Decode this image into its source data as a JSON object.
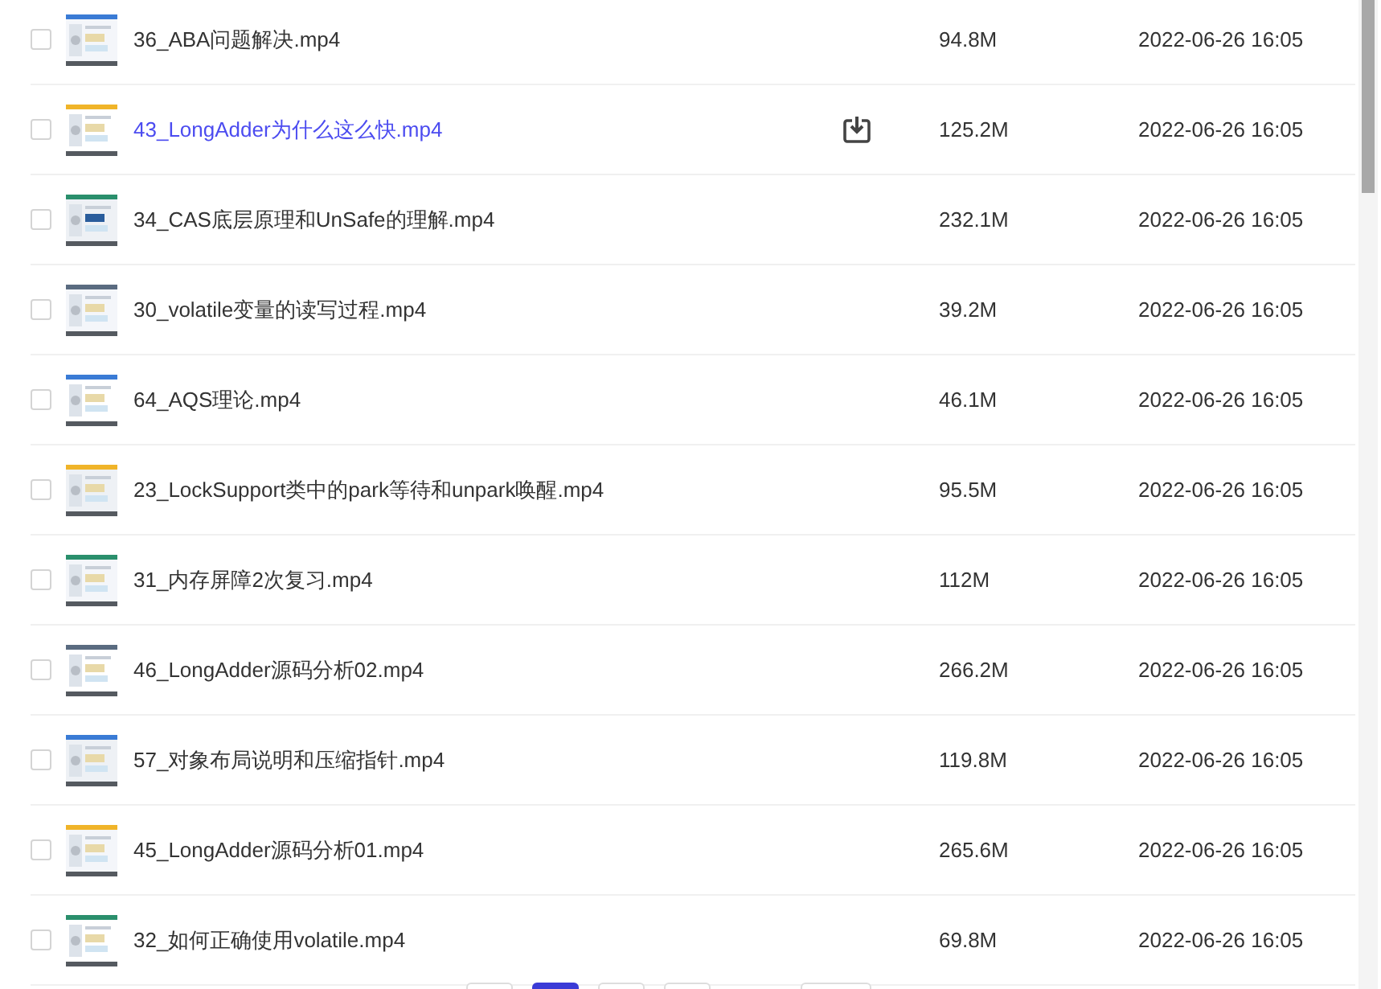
{
  "files": [
    {
      "name": "36_ABA问题解决.mp4",
      "size": "94.8M",
      "date": "2022-06-26 16:05",
      "checked": false,
      "hovered": false
    },
    {
      "name": "43_LongAdder为什么这么快.mp4",
      "size": "125.2M",
      "date": "2022-06-26 16:05",
      "checked": false,
      "hovered": true
    },
    {
      "name": "34_CAS底层原理和UnSafe的理解.mp4",
      "size": "232.1M",
      "date": "2022-06-26 16:05",
      "checked": false,
      "hovered": false
    },
    {
      "name": "30_volatile变量的读写过程.mp4",
      "size": "39.2M",
      "date": "2022-06-26 16:05",
      "checked": false,
      "hovered": false
    },
    {
      "name": "64_AQS理论.mp4",
      "size": "46.1M",
      "date": "2022-06-26 16:05",
      "checked": false,
      "hovered": false
    },
    {
      "name": "23_LockSupport类中的park等待和unpark唤醒.mp4",
      "size": "95.5M",
      "date": "2022-06-26 16:05",
      "checked": false,
      "hovered": false
    },
    {
      "name": "31_内存屏障2次复习.mp4",
      "size": "112M",
      "date": "2022-06-26 16:05",
      "checked": false,
      "hovered": false
    },
    {
      "name": "46_LongAdder源码分析02.mp4",
      "size": "266.2M",
      "date": "2022-06-26 16:05",
      "checked": false,
      "hovered": false
    },
    {
      "name": "57_对象布局说明和压缩指针.mp4",
      "size": "119.8M",
      "date": "2022-06-26 16:05",
      "checked": false,
      "hovered": false
    },
    {
      "name": "45_LongAdder源码分析01.mp4",
      "size": "265.6M",
      "date": "2022-06-26 16:05",
      "checked": false,
      "hovered": false
    },
    {
      "name": "32_如何正确使用volatile.mp4",
      "size": "69.8M",
      "date": "2022-06-26 16:05",
      "checked": false,
      "hovered": false
    }
  ],
  "pagination": [
    {
      "selected": false
    },
    {
      "selected": true
    },
    {
      "selected": false
    },
    {
      "selected": false
    },
    {
      "selected": false
    }
  ]
}
